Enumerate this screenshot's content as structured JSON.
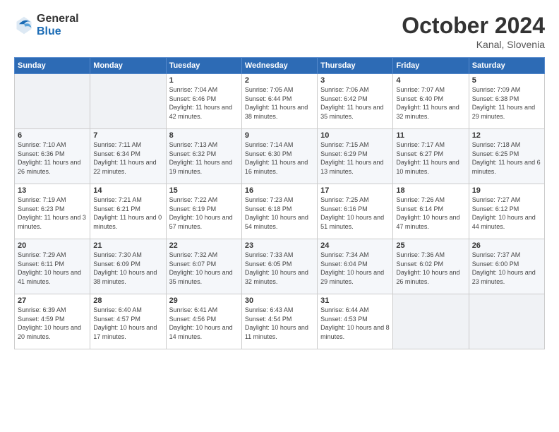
{
  "header": {
    "logo_general": "General",
    "logo_blue": "Blue",
    "month_title": "October 2024",
    "location": "Kanal, Slovenia"
  },
  "days_of_week": [
    "Sunday",
    "Monday",
    "Tuesday",
    "Wednesday",
    "Thursday",
    "Friday",
    "Saturday"
  ],
  "weeks": [
    [
      {
        "day": "",
        "info": ""
      },
      {
        "day": "",
        "info": ""
      },
      {
        "day": "1",
        "info": "Sunrise: 7:04 AM\nSunset: 6:46 PM\nDaylight: 11 hours and 42 minutes."
      },
      {
        "day": "2",
        "info": "Sunrise: 7:05 AM\nSunset: 6:44 PM\nDaylight: 11 hours and 38 minutes."
      },
      {
        "day": "3",
        "info": "Sunrise: 7:06 AM\nSunset: 6:42 PM\nDaylight: 11 hours and 35 minutes."
      },
      {
        "day": "4",
        "info": "Sunrise: 7:07 AM\nSunset: 6:40 PM\nDaylight: 11 hours and 32 minutes."
      },
      {
        "day": "5",
        "info": "Sunrise: 7:09 AM\nSunset: 6:38 PM\nDaylight: 11 hours and 29 minutes."
      }
    ],
    [
      {
        "day": "6",
        "info": "Sunrise: 7:10 AM\nSunset: 6:36 PM\nDaylight: 11 hours and 26 minutes."
      },
      {
        "day": "7",
        "info": "Sunrise: 7:11 AM\nSunset: 6:34 PM\nDaylight: 11 hours and 22 minutes."
      },
      {
        "day": "8",
        "info": "Sunrise: 7:13 AM\nSunset: 6:32 PM\nDaylight: 11 hours and 19 minutes."
      },
      {
        "day": "9",
        "info": "Sunrise: 7:14 AM\nSunset: 6:30 PM\nDaylight: 11 hours and 16 minutes."
      },
      {
        "day": "10",
        "info": "Sunrise: 7:15 AM\nSunset: 6:29 PM\nDaylight: 11 hours and 13 minutes."
      },
      {
        "day": "11",
        "info": "Sunrise: 7:17 AM\nSunset: 6:27 PM\nDaylight: 11 hours and 10 minutes."
      },
      {
        "day": "12",
        "info": "Sunrise: 7:18 AM\nSunset: 6:25 PM\nDaylight: 11 hours and 6 minutes."
      }
    ],
    [
      {
        "day": "13",
        "info": "Sunrise: 7:19 AM\nSunset: 6:23 PM\nDaylight: 11 hours and 3 minutes."
      },
      {
        "day": "14",
        "info": "Sunrise: 7:21 AM\nSunset: 6:21 PM\nDaylight: 11 hours and 0 minutes."
      },
      {
        "day": "15",
        "info": "Sunrise: 7:22 AM\nSunset: 6:19 PM\nDaylight: 10 hours and 57 minutes."
      },
      {
        "day": "16",
        "info": "Sunrise: 7:23 AM\nSunset: 6:18 PM\nDaylight: 10 hours and 54 minutes."
      },
      {
        "day": "17",
        "info": "Sunrise: 7:25 AM\nSunset: 6:16 PM\nDaylight: 10 hours and 51 minutes."
      },
      {
        "day": "18",
        "info": "Sunrise: 7:26 AM\nSunset: 6:14 PM\nDaylight: 10 hours and 47 minutes."
      },
      {
        "day": "19",
        "info": "Sunrise: 7:27 AM\nSunset: 6:12 PM\nDaylight: 10 hours and 44 minutes."
      }
    ],
    [
      {
        "day": "20",
        "info": "Sunrise: 7:29 AM\nSunset: 6:11 PM\nDaylight: 10 hours and 41 minutes."
      },
      {
        "day": "21",
        "info": "Sunrise: 7:30 AM\nSunset: 6:09 PM\nDaylight: 10 hours and 38 minutes."
      },
      {
        "day": "22",
        "info": "Sunrise: 7:32 AM\nSunset: 6:07 PM\nDaylight: 10 hours and 35 minutes."
      },
      {
        "day": "23",
        "info": "Sunrise: 7:33 AM\nSunset: 6:05 PM\nDaylight: 10 hours and 32 minutes."
      },
      {
        "day": "24",
        "info": "Sunrise: 7:34 AM\nSunset: 6:04 PM\nDaylight: 10 hours and 29 minutes."
      },
      {
        "day": "25",
        "info": "Sunrise: 7:36 AM\nSunset: 6:02 PM\nDaylight: 10 hours and 26 minutes."
      },
      {
        "day": "26",
        "info": "Sunrise: 7:37 AM\nSunset: 6:00 PM\nDaylight: 10 hours and 23 minutes."
      }
    ],
    [
      {
        "day": "27",
        "info": "Sunrise: 6:39 AM\nSunset: 4:59 PM\nDaylight: 10 hours and 20 minutes."
      },
      {
        "day": "28",
        "info": "Sunrise: 6:40 AM\nSunset: 4:57 PM\nDaylight: 10 hours and 17 minutes."
      },
      {
        "day": "29",
        "info": "Sunrise: 6:41 AM\nSunset: 4:56 PM\nDaylight: 10 hours and 14 minutes."
      },
      {
        "day": "30",
        "info": "Sunrise: 6:43 AM\nSunset: 4:54 PM\nDaylight: 10 hours and 11 minutes."
      },
      {
        "day": "31",
        "info": "Sunrise: 6:44 AM\nSunset: 4:53 PM\nDaylight: 10 hours and 8 minutes."
      },
      {
        "day": "",
        "info": ""
      },
      {
        "day": "",
        "info": ""
      }
    ]
  ]
}
